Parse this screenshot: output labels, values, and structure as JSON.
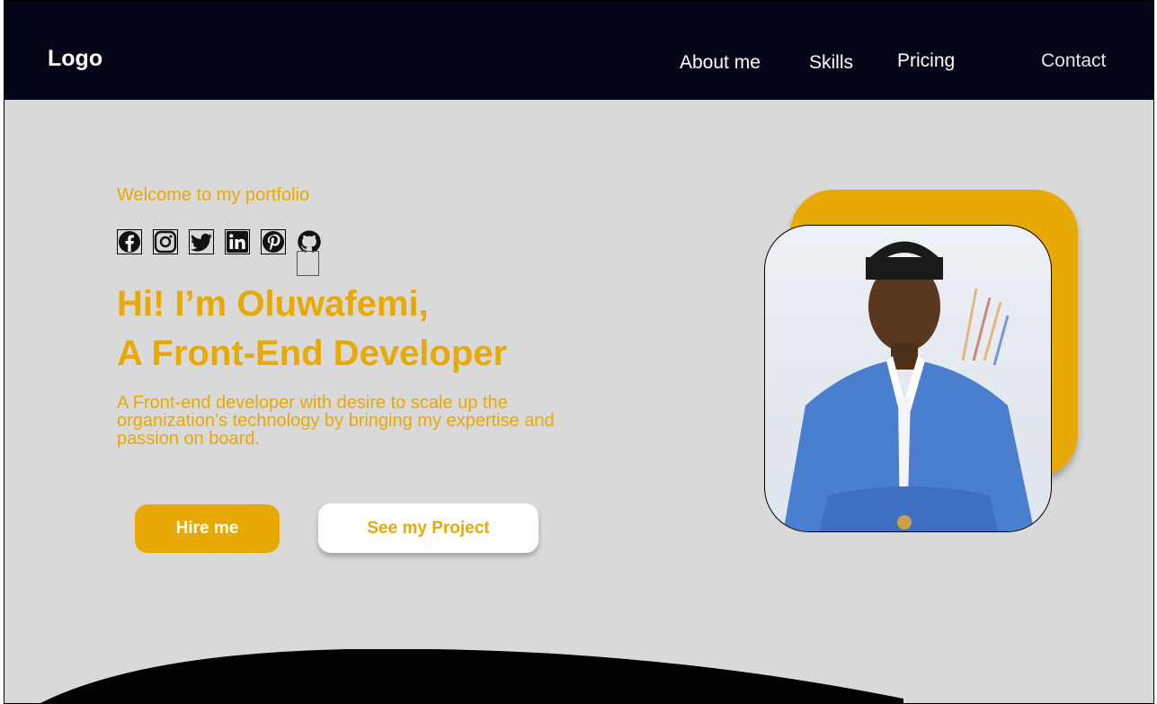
{
  "header": {
    "logo": "Logo",
    "nav": {
      "about": "About me",
      "skills": "Skills",
      "pricing": "Pricing",
      "contact": "Contact"
    }
  },
  "hero": {
    "welcome": "Welcome to my portfolio",
    "socials": [
      "facebook-icon",
      "instagram-icon",
      "twitter-icon",
      "linkedin-icon",
      "pinterest-icon",
      "github-icon"
    ],
    "headline_line1": "Hi! I’m Oluwafemi,",
    "headline_line2": "A Front-End Developer",
    "description": "A Front-end developer with desire to scale up the organization’s technology by bringing my expertise and passion on board.",
    "hire_label": "Hire me",
    "project_label": "See my Project"
  },
  "colors": {
    "accent": "#e8a905",
    "header_bg": "#020617",
    "page_bg": "#d9d9d9",
    "jacket": "#4a7fd0"
  }
}
